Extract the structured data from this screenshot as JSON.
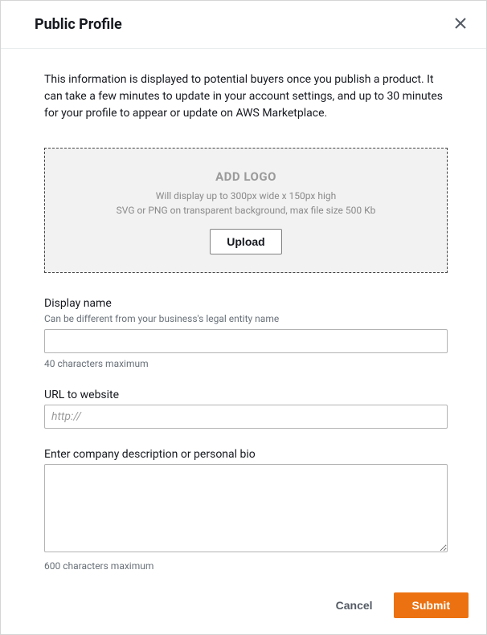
{
  "header": {
    "title": "Public Profile"
  },
  "body": {
    "intro": "This information is displayed to potential buyers once you publish a product. It can take a few minutes to update in your account settings, and up to 30 minutes for your profile to appear or update on AWS Marketplace.",
    "logo": {
      "title": "ADD LOGO",
      "line1": "Will display up to 300px wide x 150px high",
      "line2": "SVG or PNG on transparent background, max file size 500 Kb",
      "upload_label": "Upload"
    },
    "display_name": {
      "label": "Display name",
      "hint": "Can be different from your business's legal entity name",
      "value": "",
      "helper": "40 characters maximum"
    },
    "url": {
      "label": "URL to website",
      "placeholder": "http://",
      "value": ""
    },
    "description": {
      "label": "Enter company description or personal bio",
      "value": "",
      "helper": "600 characters maximum"
    }
  },
  "footer": {
    "cancel_label": "Cancel",
    "submit_label": "Submit"
  }
}
